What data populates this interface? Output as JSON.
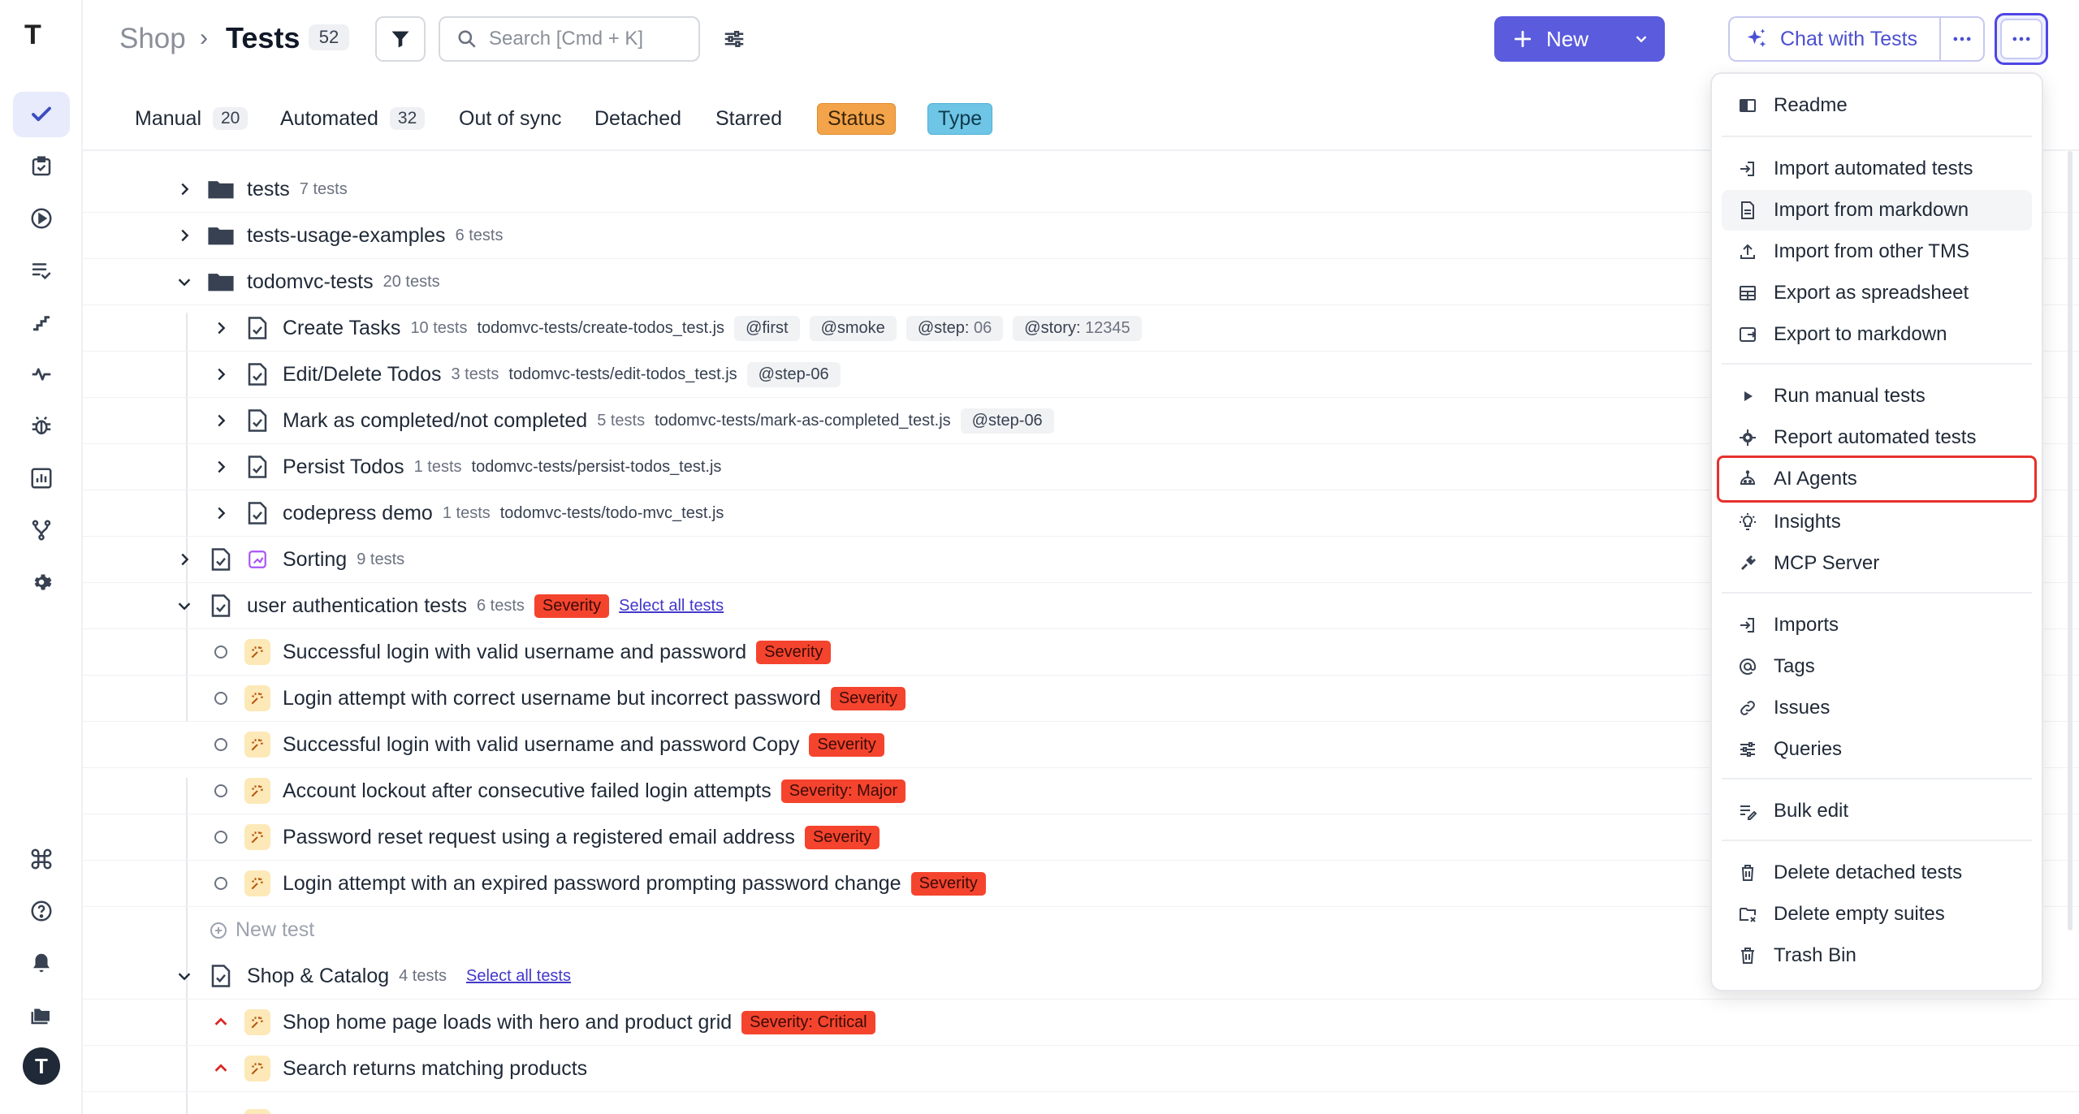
{
  "sidebar": {
    "logo": "T",
    "avatar": "T",
    "items": [
      "tests-icon",
      "runs-icon",
      "play-icon",
      "list-check-icon",
      "steps-icon",
      "pulse-icon",
      "bug-icon",
      "chart-icon",
      "branch-icon",
      "settings-icon"
    ],
    "bottom": [
      "command-icon",
      "help-icon",
      "bell-icon",
      "folders-icon"
    ]
  },
  "header": {
    "project": "Shop",
    "separator": "›",
    "title": "Tests",
    "count": "52",
    "search_placeholder": "Search [Cmd + K]",
    "new_label": "New",
    "chat_label": "Chat with Tests"
  },
  "tabs": [
    {
      "label": "Manual",
      "count": "20"
    },
    {
      "label": "Automated",
      "count": "32"
    },
    {
      "label": "Out of sync"
    },
    {
      "label": "Detached"
    },
    {
      "label": "Starred"
    },
    {
      "label": "Status"
    },
    {
      "label": "Type"
    }
  ],
  "tree": {
    "tests": {
      "name": "tests",
      "meta": "7 tests"
    },
    "usage": {
      "name": "tests-usage-examples",
      "meta": "6 tests"
    },
    "todomvc": {
      "name": "todomvc-tests",
      "meta": "20 tests"
    },
    "create": {
      "name": "Create Tasks",
      "meta": "10 tests",
      "path": "todomvc-tests/create-todos_test.js",
      "tags": [
        "@first",
        "@smoke",
        "@step:",
        "06",
        "@story:",
        "12345"
      ]
    },
    "edit": {
      "name": "Edit/Delete Todos",
      "meta": "3 tests",
      "path": "todomvc-tests/edit-todos_test.js",
      "tag": "@step-06"
    },
    "mark": {
      "name": "Mark as completed/not completed",
      "meta": "5 tests",
      "path": "todomvc-tests/mark-as-completed_test.js",
      "tag": "@step-06"
    },
    "persist": {
      "name": "Persist Todos",
      "meta": "1 tests",
      "path": "todomvc-tests/persist-todos_test.js"
    },
    "codepress": {
      "name": "codepress demo",
      "meta": "1 tests",
      "path": "todomvc-tests/todo-mvc_test.js"
    },
    "sorting": {
      "name": "Sorting",
      "meta": "9 tests"
    },
    "auth": {
      "name": "user authentication tests",
      "meta": "6 tests",
      "severity": "Severity",
      "select_all": "Select all tests"
    },
    "auth_tests": [
      {
        "name": "Successful login with valid username and password",
        "severity": "Severity"
      },
      {
        "name": "Login attempt with correct username but incorrect password",
        "severity": "Severity"
      },
      {
        "name": "Successful login with valid username and password Copy",
        "severity": "Severity"
      },
      {
        "name": "Account lockout after consecutive failed login attempts",
        "severity": "Severity: Major"
      },
      {
        "name": "Password reset request using a registered email address",
        "severity": "Severity"
      },
      {
        "name": "Login attempt with an expired password prompting password change",
        "severity": "Severity"
      }
    ],
    "new_test": "New test",
    "shop": {
      "name": "Shop & Catalog",
      "meta": "4 tests",
      "select_all": "Select all tests"
    },
    "shop_tests": [
      {
        "name": "Shop home page loads with hero and product grid",
        "severity": "Severity: Critical"
      },
      {
        "name": "Search returns matching products"
      }
    ]
  },
  "menu": {
    "readme": "Readme",
    "import_automated": "Import automated tests",
    "import_markdown": "Import from markdown",
    "import_tms": "Import from other TMS",
    "export_spreadsheet": "Export as spreadsheet",
    "export_markdown": "Export to markdown",
    "run_manual": "Run manual tests",
    "report_automated": "Report automated tests",
    "ai_agents": "AI Agents",
    "insights": "Insights",
    "mcp": "MCP Server",
    "imports": "Imports",
    "tags": "Tags",
    "issues": "Issues",
    "queries": "Queries",
    "bulk_edit": "Bulk edit",
    "delete_detached": "Delete detached tests",
    "delete_empty": "Delete empty suites",
    "trash": "Trash Bin"
  },
  "colors": {
    "accent": "#5b5bde",
    "severity": "#f4442e",
    "status": "#f3a44a",
    "type": "#6ec5e6",
    "highlight": "#e5322d"
  }
}
